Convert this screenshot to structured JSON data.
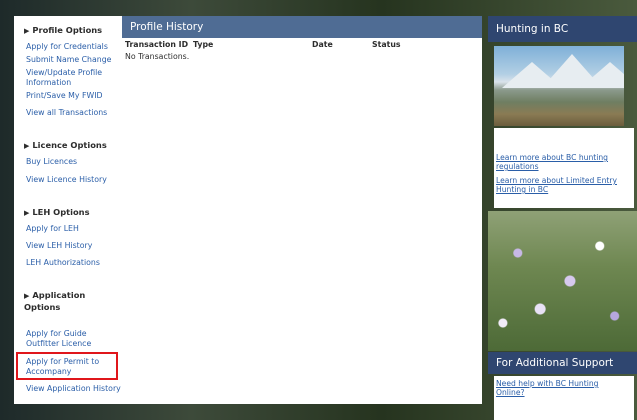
{
  "sidebar": {
    "sections": [
      {
        "title": "Profile Options",
        "links": [
          "Apply for Credentials",
          "Submit Name Change",
          "View/Update Profile Information",
          "Print/Save My FWID",
          "View all Transactions"
        ]
      },
      {
        "title": "Licence Options",
        "links": [
          "Buy Licences",
          "View Licence History"
        ]
      },
      {
        "title": "LEH Options",
        "links": [
          "Apply for LEH",
          "View LEH History",
          "LEH Authorizations"
        ]
      },
      {
        "title": "Application Options",
        "links": [
          "Apply for Guide Outfitter Licence",
          "Apply for Permit to Accompany",
          "View Application History"
        ]
      }
    ]
  },
  "main": {
    "title": "Profile History",
    "columns": [
      "Transaction ID",
      "Type",
      "Date",
      "Status"
    ],
    "empty_message": "No Transactions."
  },
  "right": {
    "title": "Hunting in BC",
    "links": [
      "Learn more about BC hunting regulations",
      "Learn more about Limited Entry Hunting in BC"
    ],
    "support_title": "For Additional Support",
    "support_link": "Need help with BC Hunting Online?"
  },
  "colors": {
    "header_blue": "#4f6c94",
    "right_header_blue": "#2f4670",
    "link_blue": "#2a5ea8",
    "highlight_red": "#e0161b"
  }
}
